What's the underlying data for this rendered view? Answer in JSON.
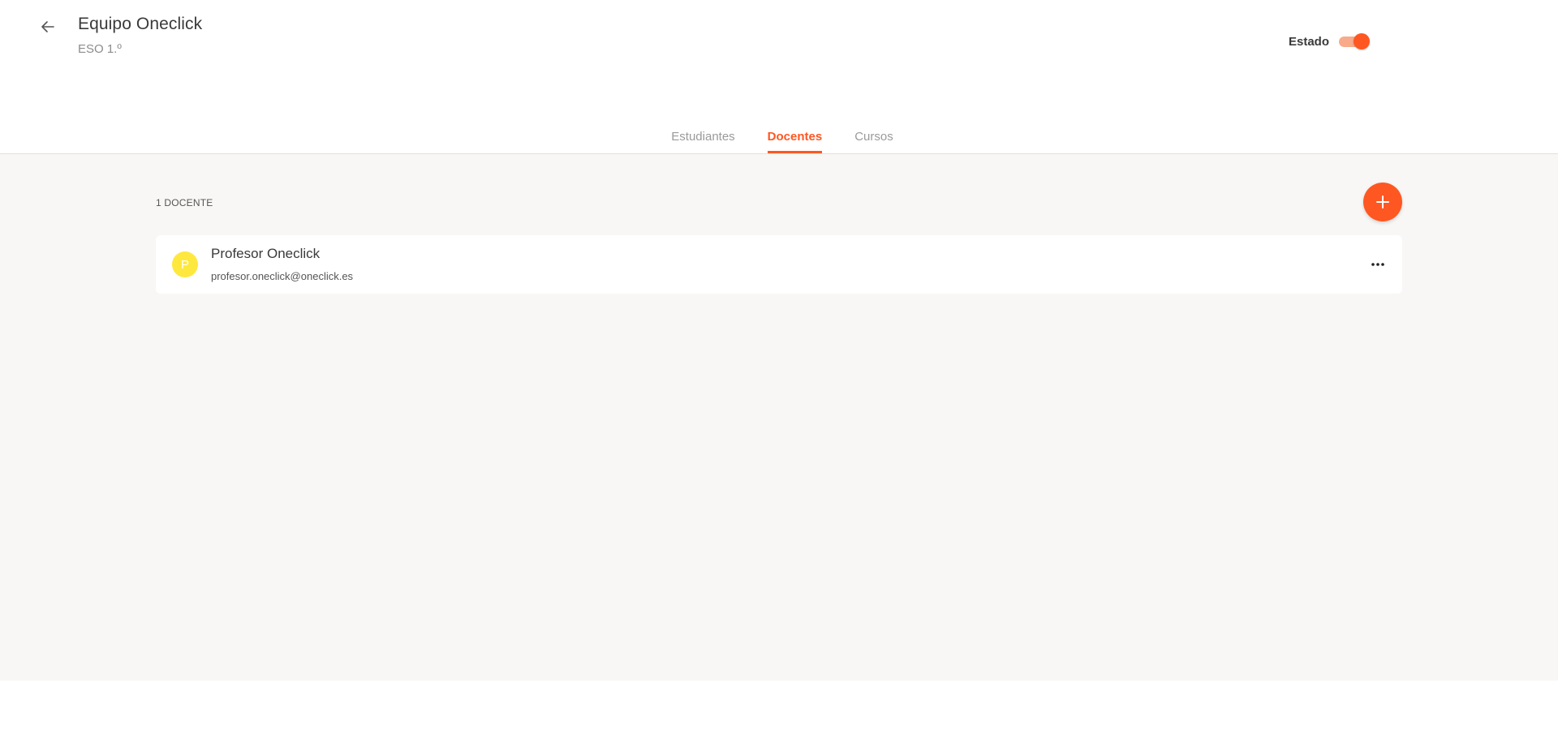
{
  "header": {
    "title": "Equipo Oneclick",
    "subtitle": "ESO 1.º",
    "status_label": "Estado",
    "status_enabled": true
  },
  "tabs": [
    {
      "label": "Estudiantes",
      "active": false
    },
    {
      "label": "Docentes",
      "active": true
    },
    {
      "label": "Cursos",
      "active": false
    }
  ],
  "main": {
    "count_label": "1 DOCENTE",
    "members": [
      {
        "initial": "P",
        "name": "Profesor Oneclick",
        "email": "profesor.oneclick@oneclick.es",
        "avatar_color": "#fee83e"
      }
    ]
  },
  "icons": {
    "back": "arrow-left-icon",
    "add": "plus-icon",
    "more": "more-horizontal-icon"
  },
  "colors": {
    "accent": "#ff5722",
    "toggle_track": "#f7ab8a",
    "content_bg": "#f8f7f5"
  }
}
